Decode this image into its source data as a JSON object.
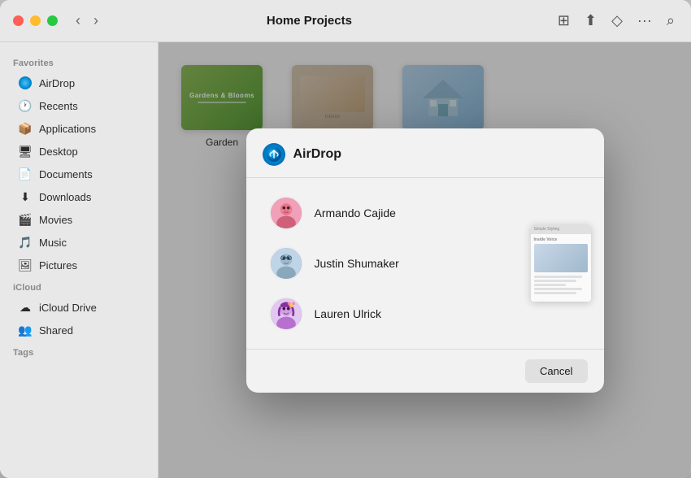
{
  "window": {
    "title": "Home Projects"
  },
  "toolbar": {
    "back_label": "‹",
    "forward_label": "›",
    "view_icon": "⊞",
    "share_icon": "⬆",
    "tag_icon": "◇",
    "more_icon": "···",
    "search_icon": "⌕"
  },
  "sidebar": {
    "favorites_label": "Favorites",
    "icloud_label": "iCloud",
    "tags_label": "Tags",
    "items": [
      {
        "id": "airdrop",
        "label": "AirDrop",
        "icon": "airdrop"
      },
      {
        "id": "recents",
        "label": "Recents",
        "icon": "🕐"
      },
      {
        "id": "applications",
        "label": "Applications",
        "icon": "📦"
      },
      {
        "id": "desktop",
        "label": "Desktop",
        "icon": "🖥"
      },
      {
        "id": "documents",
        "label": "Documents",
        "icon": "📄"
      },
      {
        "id": "downloads",
        "label": "Downloads",
        "icon": "⬇"
      },
      {
        "id": "movies",
        "label": "Movies",
        "icon": "🎬"
      },
      {
        "id": "music",
        "label": "Music",
        "icon": "🎵"
      },
      {
        "id": "pictures",
        "label": "Pictures",
        "icon": "🖼"
      }
    ],
    "icloud_items": [
      {
        "id": "icloud-drive",
        "label": "iCloud Drive",
        "icon": "☁"
      },
      {
        "id": "shared",
        "label": "Shared",
        "icon": "👥"
      }
    ]
  },
  "files": [
    {
      "id": "garden",
      "name": "Garden",
      "type": "garden"
    },
    {
      "id": "simple-styling",
      "name": "Simple Styling",
      "type": "styling",
      "selected": true
    },
    {
      "id": "house",
      "name": "House",
      "type": "house"
    }
  ],
  "dialog": {
    "title": "AirDrop",
    "contacts": [
      {
        "id": "armando",
        "name": "Armando Cajide",
        "avatar_type": "armando"
      },
      {
        "id": "justin",
        "name": "Justin Shumaker",
        "avatar_type": "justin"
      },
      {
        "id": "lauren",
        "name": "Lauren Ulrick",
        "avatar_type": "lauren"
      }
    ],
    "cancel_label": "Cancel",
    "preview_title": "Simple Styling\nInside Voice"
  }
}
